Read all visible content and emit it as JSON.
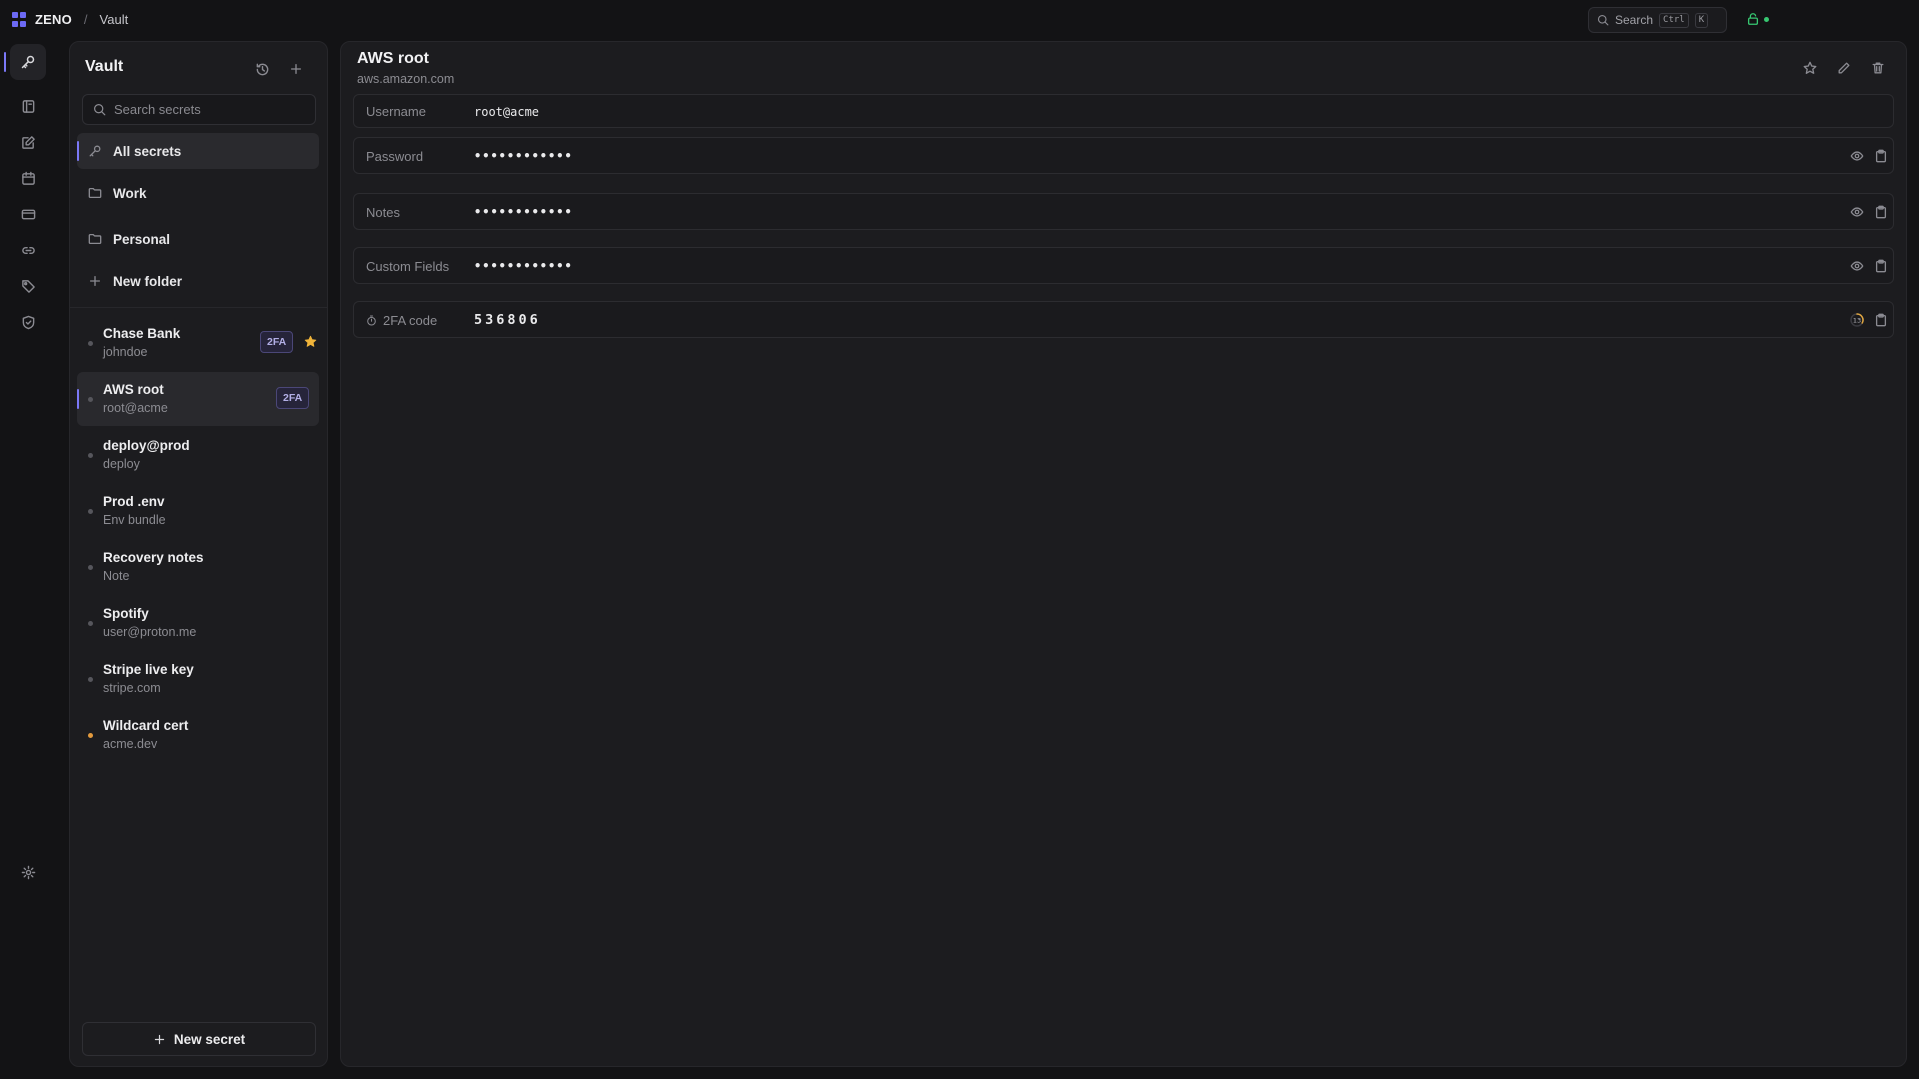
{
  "app": {
    "name": "ZENO",
    "breadcrumb": "Vault"
  },
  "topbar": {
    "search_label": "Search",
    "kbd_ctrl": "Ctrl",
    "kbd_k": "K",
    "status": "unlocked"
  },
  "rail": {
    "items": [
      {
        "icon": "key-icon",
        "active": true
      },
      {
        "icon": "notebook-icon",
        "active": false
      },
      {
        "icon": "edit-note-icon",
        "active": false
      },
      {
        "icon": "calendar-icon",
        "active": false
      },
      {
        "icon": "card-icon",
        "active": false
      },
      {
        "icon": "link-icon",
        "active": false
      },
      {
        "icon": "tag-icon",
        "active": false
      },
      {
        "icon": "shield-icon",
        "active": false
      }
    ],
    "settings_icon": "gear-icon"
  },
  "vault": {
    "title": "Vault",
    "search_placeholder": "Search secrets",
    "folders": [
      {
        "label": "All secrets",
        "icon": "key-icon"
      },
      {
        "label": "Work",
        "icon": "folder-icon"
      },
      {
        "label": "Personal",
        "icon": "folder-icon"
      },
      {
        "label": "New folder",
        "icon": "plus-icon"
      }
    ],
    "entries": [
      {
        "title": "Chase Bank",
        "sub": "johndoe",
        "badge": "2FA",
        "starred": true
      },
      {
        "title": "AWS root",
        "sub": "root@acme",
        "badge": "2FA",
        "active": true
      },
      {
        "title": "deploy@prod",
        "sub": "deploy"
      },
      {
        "title": "Prod .env",
        "sub": "Env bundle"
      },
      {
        "title": "Recovery notes",
        "sub": "Note"
      },
      {
        "title": "Spotify",
        "sub": "user@proton.me"
      },
      {
        "title": "Stripe live key",
        "sub": "stripe.com"
      },
      {
        "title": "Wildcard cert",
        "sub": "acme.dev",
        "dot_color": "#e39a3d"
      }
    ],
    "new_secret_label": "New secret"
  },
  "detail": {
    "title": "AWS root",
    "subtitle": "aws.amazon.com",
    "fields": [
      {
        "label": "Username",
        "value": "root@acme"
      },
      {
        "label": "Password",
        "value": "••••••••••••"
      },
      {
        "label": "Notes",
        "value": "••••••••••••"
      },
      {
        "label": "Custom Fields",
        "value": "••••••••••••"
      },
      {
        "label": "2FA code",
        "value": "536806",
        "timer": "13"
      }
    ]
  },
  "colors": {
    "accent": "#7b78f7",
    "star": "#f0b43a",
    "status_green": "#37c871",
    "warn_dot": "#e39a3d"
  }
}
